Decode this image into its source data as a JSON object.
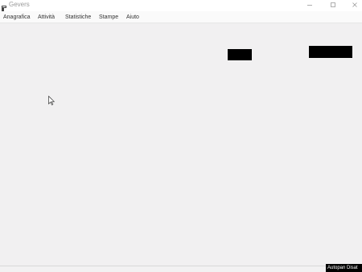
{
  "window": {
    "title": "Gevers",
    "icon": "app-icon",
    "controls": {
      "minimize": "minimize-icon",
      "maximize": "maximize-icon",
      "close": "close-icon"
    }
  },
  "menu": {
    "items": [
      {
        "label": "Anagrafica"
      },
      {
        "label": "Attività"
      },
      {
        "label": "Statistiche"
      },
      {
        "label": "Stampe"
      },
      {
        "label": "Aiuto"
      }
    ]
  },
  "status": {
    "autopan": "Autopan Disat"
  },
  "colors": {
    "titlebar": "#ffffff",
    "workspace": "#f1f0f1",
    "redaction": "#000000"
  }
}
